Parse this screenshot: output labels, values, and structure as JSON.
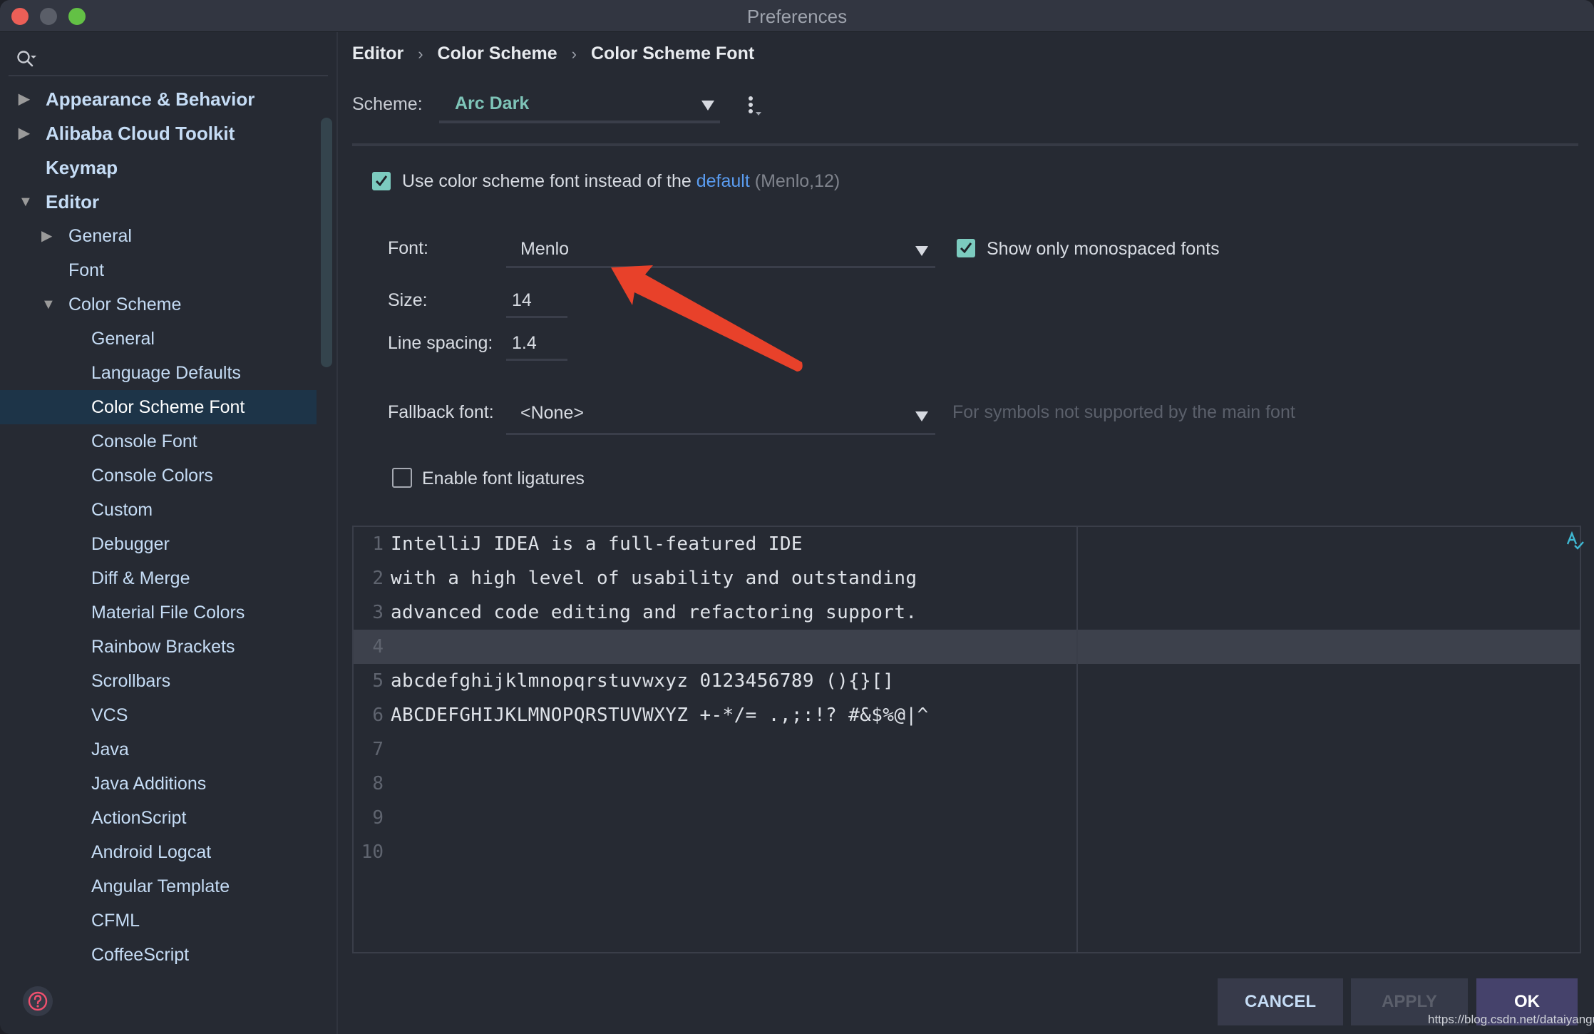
{
  "window": {
    "title": "Preferences"
  },
  "sidebar": {
    "search_placeholder": "",
    "items": [
      {
        "label": "Appearance & Behavior",
        "level": 0,
        "bold": true,
        "arrow": "collapsed"
      },
      {
        "label": "Alibaba Cloud Toolkit",
        "level": 0,
        "bold": true,
        "arrow": "collapsed"
      },
      {
        "label": "Keymap",
        "level": 0,
        "bold": true,
        "arrow": "none"
      },
      {
        "label": "Editor",
        "level": 0,
        "bold": true,
        "arrow": "expanded"
      },
      {
        "label": "General",
        "level": 1,
        "bold": false,
        "arrow": "collapsed"
      },
      {
        "label": "Font",
        "level": 1,
        "bold": false,
        "arrow": "none"
      },
      {
        "label": "Color Scheme",
        "level": 1,
        "bold": false,
        "arrow": "expanded"
      },
      {
        "label": "General",
        "level": 2,
        "bold": false,
        "arrow": "none"
      },
      {
        "label": "Language Defaults",
        "level": 2,
        "bold": false,
        "arrow": "none"
      },
      {
        "label": "Color Scheme Font",
        "level": 2,
        "bold": false,
        "arrow": "none",
        "selected": true
      },
      {
        "label": "Console Font",
        "level": 2,
        "bold": false,
        "arrow": "none"
      },
      {
        "label": "Console Colors",
        "level": 2,
        "bold": false,
        "arrow": "none"
      },
      {
        "label": "Custom",
        "level": 2,
        "bold": false,
        "arrow": "none"
      },
      {
        "label": "Debugger",
        "level": 2,
        "bold": false,
        "arrow": "none"
      },
      {
        "label": "Diff & Merge",
        "level": 2,
        "bold": false,
        "arrow": "none"
      },
      {
        "label": "Material File Colors",
        "level": 2,
        "bold": false,
        "arrow": "none"
      },
      {
        "label": "Rainbow Brackets",
        "level": 2,
        "bold": false,
        "arrow": "none"
      },
      {
        "label": "Scrollbars",
        "level": 2,
        "bold": false,
        "arrow": "none"
      },
      {
        "label": "VCS",
        "level": 2,
        "bold": false,
        "arrow": "none"
      },
      {
        "label": "Java",
        "level": 2,
        "bold": false,
        "arrow": "none"
      },
      {
        "label": "Java Additions",
        "level": 2,
        "bold": false,
        "arrow": "none"
      },
      {
        "label": "ActionScript",
        "level": 2,
        "bold": false,
        "arrow": "none"
      },
      {
        "label": "Android Logcat",
        "level": 2,
        "bold": false,
        "arrow": "none"
      },
      {
        "label": "Angular Template",
        "level": 2,
        "bold": false,
        "arrow": "none"
      },
      {
        "label": "CFML",
        "level": 2,
        "bold": false,
        "arrow": "none"
      },
      {
        "label": "CoffeeScript",
        "level": 2,
        "bold": false,
        "arrow": "none"
      }
    ]
  },
  "breadcrumb": [
    "Editor",
    "Color Scheme",
    "Color Scheme Font"
  ],
  "breadcrumb_separator": "›",
  "scheme": {
    "label": "Scheme:",
    "value": "Arc Dark"
  },
  "use_scheme_font": {
    "checked": true,
    "text_before": "Use color scheme font instead of the",
    "link": "default",
    "default_info": "(Menlo,12)"
  },
  "font": {
    "label": "Font:",
    "value": "Menlo"
  },
  "monospaced_only": {
    "checked": true,
    "label": "Show only monospaced fonts"
  },
  "size": {
    "label": "Size:",
    "value": "14"
  },
  "line_spacing": {
    "label": "Line spacing:",
    "value": "1.4"
  },
  "fallback_font": {
    "label": "Fallback font:",
    "value": "<None>",
    "hint": "For symbols not supported by the main font"
  },
  "ligatures": {
    "checked": false,
    "label": "Enable font ligatures"
  },
  "preview": {
    "current_line": 4,
    "lines": [
      {
        "n": "1",
        "text": "IntelliJ IDEA is a full-featured IDE"
      },
      {
        "n": "2",
        "text": "with a high level of usability and outstanding"
      },
      {
        "n": "3",
        "text": "advanced code editing and refactoring support."
      },
      {
        "n": "4",
        "text": ""
      },
      {
        "n": "5",
        "text": "abcdefghijklmnopqrstuvwxyz 0123456789 (){}[]"
      },
      {
        "n": "6",
        "text": "ABCDEFGHIJKLMNOPQRSTUVWXYZ +-*/= .,;:!? #&$%@|^"
      },
      {
        "n": "7",
        "text": ""
      },
      {
        "n": "8",
        "text": ""
      },
      {
        "n": "9",
        "text": ""
      },
      {
        "n": "10",
        "text": ""
      }
    ]
  },
  "buttons": {
    "cancel": "CANCEL",
    "apply": "APPLY",
    "ok": "OK"
  },
  "watermark": "https://blog.csdn.net/dataiyangu",
  "colors": {
    "accent_teal": "#7ccbbf",
    "link_blue": "#5a9cf0",
    "selection": "#1d3448",
    "annotation_arrow": "#e8412a",
    "help_icon": "#f0506e"
  }
}
